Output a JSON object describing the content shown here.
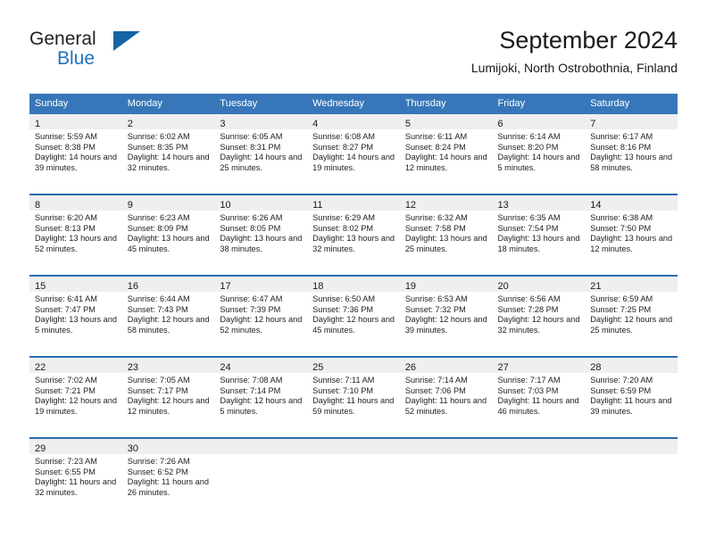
{
  "logo": {
    "word_one": "General",
    "word_two": "Blue",
    "triangle_icon": "triangle-icon"
  },
  "header": {
    "title": "September 2024",
    "subtitle": "Lumijoki, North Ostrobothnia, Finland"
  },
  "colors": {
    "header_blue": "#3777b9",
    "row_divider_blue": "#2b6cad",
    "daynum_band": "#efefef",
    "logo_blue": "#1e73be"
  },
  "calendar": {
    "weekday_headers": [
      "Sunday",
      "Monday",
      "Tuesday",
      "Wednesday",
      "Thursday",
      "Friday",
      "Saturday"
    ],
    "weeks": [
      [
        {
          "day": "1",
          "sunrise": "Sunrise: 5:59 AM",
          "sunset": "Sunset: 8:38 PM",
          "daylight": "Daylight: 14 hours and 39 minutes."
        },
        {
          "day": "2",
          "sunrise": "Sunrise: 6:02 AM",
          "sunset": "Sunset: 8:35 PM",
          "daylight": "Daylight: 14 hours and 32 minutes."
        },
        {
          "day": "3",
          "sunrise": "Sunrise: 6:05 AM",
          "sunset": "Sunset: 8:31 PM",
          "daylight": "Daylight: 14 hours and 25 minutes."
        },
        {
          "day": "4",
          "sunrise": "Sunrise: 6:08 AM",
          "sunset": "Sunset: 8:27 PM",
          "daylight": "Daylight: 14 hours and 19 minutes."
        },
        {
          "day": "5",
          "sunrise": "Sunrise: 6:11 AM",
          "sunset": "Sunset: 8:24 PM",
          "daylight": "Daylight: 14 hours and 12 minutes."
        },
        {
          "day": "6",
          "sunrise": "Sunrise: 6:14 AM",
          "sunset": "Sunset: 8:20 PM",
          "daylight": "Daylight: 14 hours and 5 minutes."
        },
        {
          "day": "7",
          "sunrise": "Sunrise: 6:17 AM",
          "sunset": "Sunset: 8:16 PM",
          "daylight": "Daylight: 13 hours and 58 minutes."
        }
      ],
      [
        {
          "day": "8",
          "sunrise": "Sunrise: 6:20 AM",
          "sunset": "Sunset: 8:13 PM",
          "daylight": "Daylight: 13 hours and 52 minutes."
        },
        {
          "day": "9",
          "sunrise": "Sunrise: 6:23 AM",
          "sunset": "Sunset: 8:09 PM",
          "daylight": "Daylight: 13 hours and 45 minutes."
        },
        {
          "day": "10",
          "sunrise": "Sunrise: 6:26 AM",
          "sunset": "Sunset: 8:05 PM",
          "daylight": "Daylight: 13 hours and 38 minutes."
        },
        {
          "day": "11",
          "sunrise": "Sunrise: 6:29 AM",
          "sunset": "Sunset: 8:02 PM",
          "daylight": "Daylight: 13 hours and 32 minutes."
        },
        {
          "day": "12",
          "sunrise": "Sunrise: 6:32 AM",
          "sunset": "Sunset: 7:58 PM",
          "daylight": "Daylight: 13 hours and 25 minutes."
        },
        {
          "day": "13",
          "sunrise": "Sunrise: 6:35 AM",
          "sunset": "Sunset: 7:54 PM",
          "daylight": "Daylight: 13 hours and 18 minutes."
        },
        {
          "day": "14",
          "sunrise": "Sunrise: 6:38 AM",
          "sunset": "Sunset: 7:50 PM",
          "daylight": "Daylight: 13 hours and 12 minutes."
        }
      ],
      [
        {
          "day": "15",
          "sunrise": "Sunrise: 6:41 AM",
          "sunset": "Sunset: 7:47 PM",
          "daylight": "Daylight: 13 hours and 5 minutes."
        },
        {
          "day": "16",
          "sunrise": "Sunrise: 6:44 AM",
          "sunset": "Sunset: 7:43 PM",
          "daylight": "Daylight: 12 hours and 58 minutes."
        },
        {
          "day": "17",
          "sunrise": "Sunrise: 6:47 AM",
          "sunset": "Sunset: 7:39 PM",
          "daylight": "Daylight: 12 hours and 52 minutes."
        },
        {
          "day": "18",
          "sunrise": "Sunrise: 6:50 AM",
          "sunset": "Sunset: 7:36 PM",
          "daylight": "Daylight: 12 hours and 45 minutes."
        },
        {
          "day": "19",
          "sunrise": "Sunrise: 6:53 AM",
          "sunset": "Sunset: 7:32 PM",
          "daylight": "Daylight: 12 hours and 39 minutes."
        },
        {
          "day": "20",
          "sunrise": "Sunrise: 6:56 AM",
          "sunset": "Sunset: 7:28 PM",
          "daylight": "Daylight: 12 hours and 32 minutes."
        },
        {
          "day": "21",
          "sunrise": "Sunrise: 6:59 AM",
          "sunset": "Sunset: 7:25 PM",
          "daylight": "Daylight: 12 hours and 25 minutes."
        }
      ],
      [
        {
          "day": "22",
          "sunrise": "Sunrise: 7:02 AM",
          "sunset": "Sunset: 7:21 PM",
          "daylight": "Daylight: 12 hours and 19 minutes."
        },
        {
          "day": "23",
          "sunrise": "Sunrise: 7:05 AM",
          "sunset": "Sunset: 7:17 PM",
          "daylight": "Daylight: 12 hours and 12 minutes."
        },
        {
          "day": "24",
          "sunrise": "Sunrise: 7:08 AM",
          "sunset": "Sunset: 7:14 PM",
          "daylight": "Daylight: 12 hours and 5 minutes."
        },
        {
          "day": "25",
          "sunrise": "Sunrise: 7:11 AM",
          "sunset": "Sunset: 7:10 PM",
          "daylight": "Daylight: 11 hours and 59 minutes."
        },
        {
          "day": "26",
          "sunrise": "Sunrise: 7:14 AM",
          "sunset": "Sunset: 7:06 PM",
          "daylight": "Daylight: 11 hours and 52 minutes."
        },
        {
          "day": "27",
          "sunrise": "Sunrise: 7:17 AM",
          "sunset": "Sunset: 7:03 PM",
          "daylight": "Daylight: 11 hours and 46 minutes."
        },
        {
          "day": "28",
          "sunrise": "Sunrise: 7:20 AM",
          "sunset": "Sunset: 6:59 PM",
          "daylight": "Daylight: 11 hours and 39 minutes."
        }
      ],
      [
        {
          "day": "29",
          "sunrise": "Sunrise: 7:23 AM",
          "sunset": "Sunset: 6:55 PM",
          "daylight": "Daylight: 11 hours and 32 minutes."
        },
        {
          "day": "30",
          "sunrise": "Sunrise: 7:26 AM",
          "sunset": "Sunset: 6:52 PM",
          "daylight": "Daylight: 11 hours and 26 minutes."
        },
        {
          "day": "",
          "sunrise": "",
          "sunset": "",
          "daylight": ""
        },
        {
          "day": "",
          "sunrise": "",
          "sunset": "",
          "daylight": ""
        },
        {
          "day": "",
          "sunrise": "",
          "sunset": "",
          "daylight": ""
        },
        {
          "day": "",
          "sunrise": "",
          "sunset": "",
          "daylight": ""
        },
        {
          "day": "",
          "sunrise": "",
          "sunset": "",
          "daylight": ""
        }
      ]
    ]
  }
}
